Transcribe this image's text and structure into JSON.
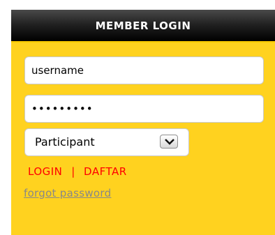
{
  "login_panel": {
    "title": "MEMBER LOGIN",
    "username_value": "username",
    "password_value": "*********",
    "role_selected": "Participant",
    "login_label": "LOGIN",
    "separator": "|",
    "register_label": "DAFTAR",
    "forgot_label": "forgot password"
  },
  "colors": {
    "panel_background": "#ffd21f",
    "header_background": "#000000",
    "link_red": "#ff0000",
    "forgot_gray": "#888888"
  }
}
